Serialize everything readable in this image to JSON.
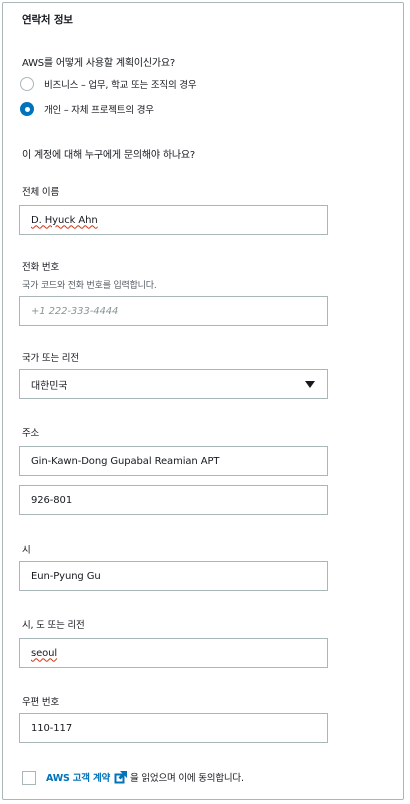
{
  "section_title": "연락처 정보",
  "account_use": {
    "question": "AWS를 어떻게 사용할 계획이신가요?",
    "options": [
      {
        "label": "비즈니스 – 업무, 학교 또는 조직의 경우",
        "selected": false
      },
      {
        "label": "개인 – 자체 프로젝트의 경우",
        "selected": true
      }
    ]
  },
  "contact_question": "이 계정에 대해 누구에게 문의해야 하나요?",
  "full_name": {
    "label": "전체 이름",
    "value": "D. Hyuck Ahn"
  },
  "phone": {
    "label": "전화 번호",
    "description": "국가 코드와 전화 번호를 입력합니다.",
    "placeholder": "+1 222-333-4444"
  },
  "country": {
    "label": "국가 또는 리전",
    "value": "대한민국",
    "icon": "triangle-down-icon"
  },
  "address": {
    "label": "주소",
    "line1": "Gin-Kawn-Dong Gupabal Reamian APT",
    "line2": "926-801"
  },
  "city": {
    "label": "시",
    "value": "Eun-Pyung Gu"
  },
  "state": {
    "label": "시, 도 또는 리전",
    "value": "seoul"
  },
  "postal_code": {
    "label": "우편 번호",
    "value": "110-117"
  },
  "agreement": {
    "link_text": "AWS 고객 계약",
    "suffix": "을 읽었으며 이에 동의합니다.",
    "icon": "external-link-icon",
    "checked": false
  },
  "colors": {
    "accent": "#0073bb",
    "border": "#aab7b8",
    "text": "#16191f",
    "spellcheck": "#d13212"
  }
}
